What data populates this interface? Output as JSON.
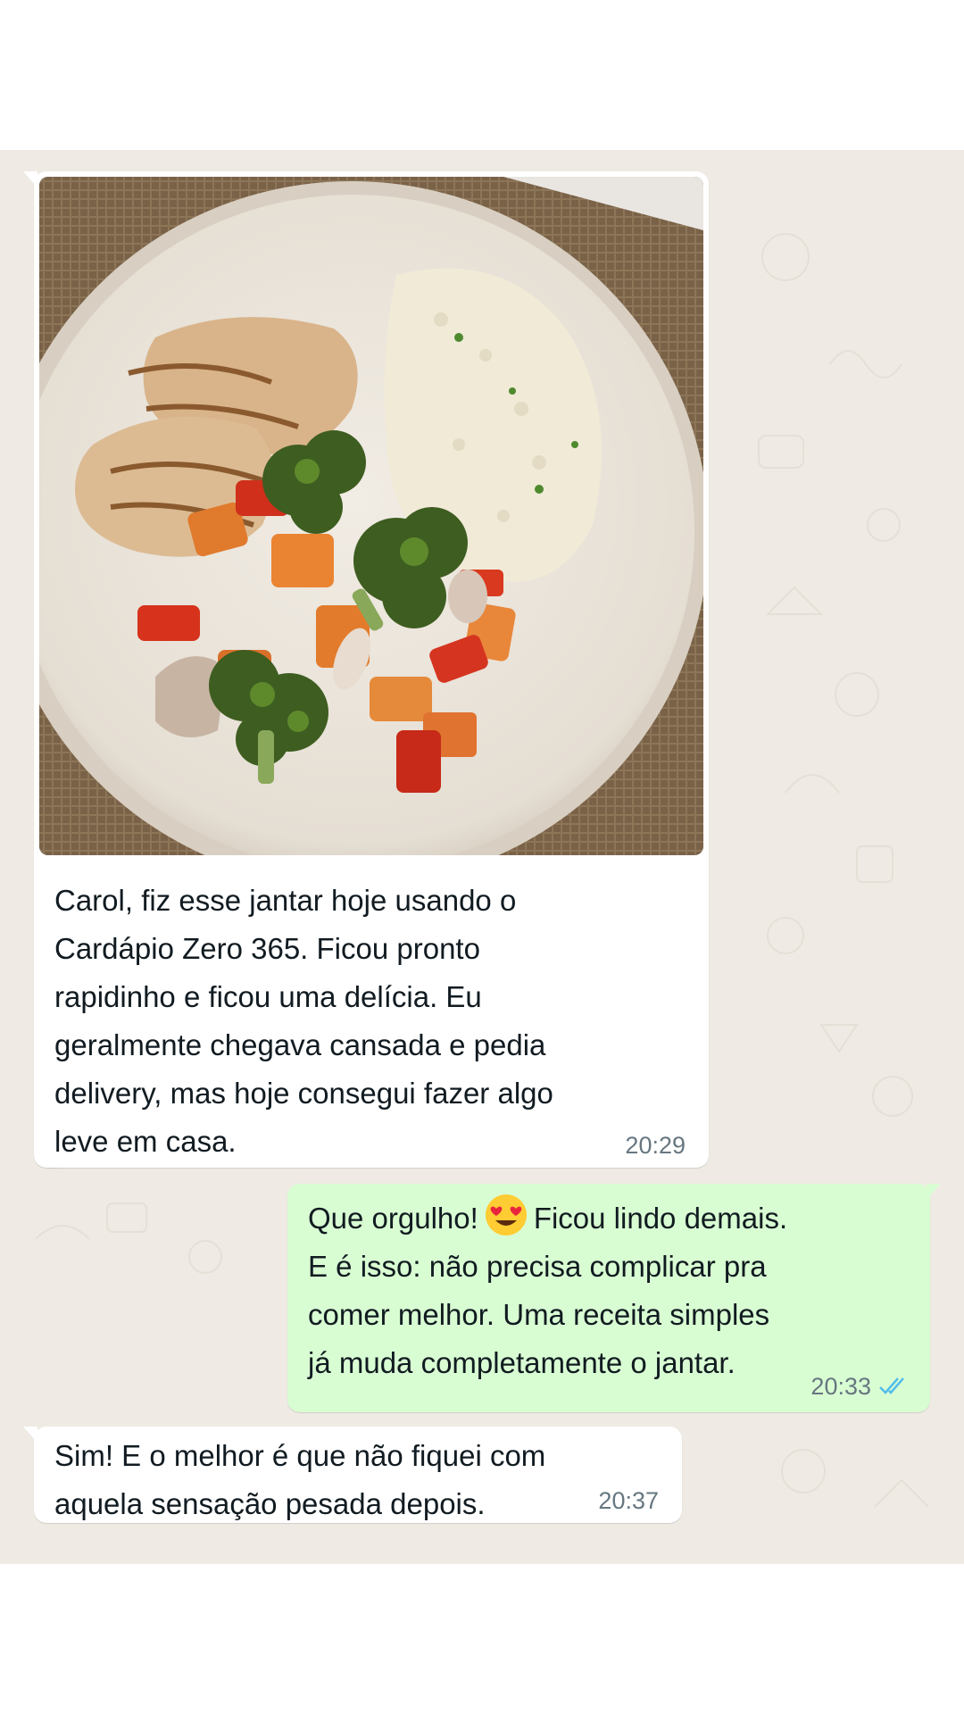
{
  "messages": [
    {
      "direction": "incoming",
      "has_photo": true,
      "photo_description": "plate-with-grilled-chicken-cauliflower-rice-and-roasted-vegetables",
      "text": "Carol, fiz esse jantar hoje usando o\nCardápio Zero 365. Ficou pronto\nrapidinho e ficou uma delícia. Eu\ngeralmente chegava cansada e pedia\ndelivery, mas hoje consegui fazer algo\nleve em casa.",
      "time": "20:29"
    },
    {
      "direction": "outgoing",
      "text_before_emoji": "Que orgulho!",
      "emoji": "smiling-face-with-heart-eyes",
      "text_after_emoji": "Ficou lindo demais.\nE é isso: não precisa complicar pra\ncomer melhor. Uma receita simples\njá muda completamente o jantar.",
      "time": "20:33",
      "status_icon": "double-check-read-icon"
    },
    {
      "direction": "incoming",
      "text": "Sim! E o melhor é que não fiquei com\naquela sensação pesada depois.",
      "time": "20:37"
    }
  ],
  "colors": {
    "chat_background": "#efebe4",
    "incoming_bubble": "#ffffff",
    "outgoing_bubble": "#d9fdd3",
    "text": "#111b21",
    "timestamp": "#667781",
    "read_check": "#53bdeb"
  }
}
